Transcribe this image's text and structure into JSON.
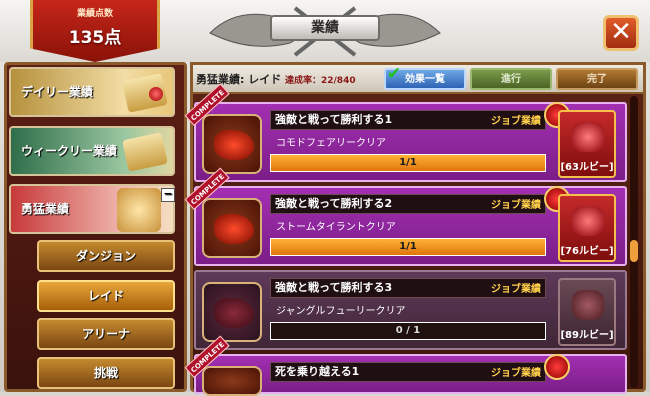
{
  "header": {
    "score_label": "業績点数",
    "score_value": "135点",
    "title": "業績",
    "close_label": "✕"
  },
  "categories": [
    {
      "label": "デイリー業績"
    },
    {
      "label": "ウィークリー業績"
    },
    {
      "label": "勇猛業績"
    }
  ],
  "subcategories": [
    {
      "label": "ダンジョン"
    },
    {
      "label": "レイド"
    },
    {
      "label": "アリーナ"
    },
    {
      "label": "挑戦"
    }
  ],
  "panel": {
    "title": "勇猛業績: レイド",
    "rate": "達成率：22/840",
    "tabs": {
      "all": "効果一覧",
      "progress": "進行",
      "done": "完了"
    }
  },
  "entries": [
    {
      "name": "強敵と戦って勝利する1",
      "job": "ジョブ業績",
      "desc": "コモドフェアリークリア",
      "progress_text": "1/1",
      "progress": 1.0,
      "reward": "[63ルビー]",
      "completed": true,
      "complete_label": "COMPLETE"
    },
    {
      "name": "強敵と戦って勝利する2",
      "job": "ジョブ業績",
      "desc": "ストームタイラントクリア",
      "progress_text": "1/1",
      "progress": 1.0,
      "reward": "[76ルビー]",
      "completed": true,
      "complete_label": "COMPLETE"
    },
    {
      "name": "強敵と戦って勝利する3",
      "job": "ジョブ業績",
      "desc": "ジャングルフューリークリア",
      "progress_text": "0 / 1",
      "progress": 0.0,
      "reward": "[89ルビー]",
      "completed": false
    },
    {
      "name": "死を乗り越える1",
      "job": "ジョブ業績",
      "desc": "",
      "progress_text": "",
      "progress": 1.0,
      "reward": "",
      "completed": true,
      "complete_label": "COMPLETE"
    }
  ]
}
